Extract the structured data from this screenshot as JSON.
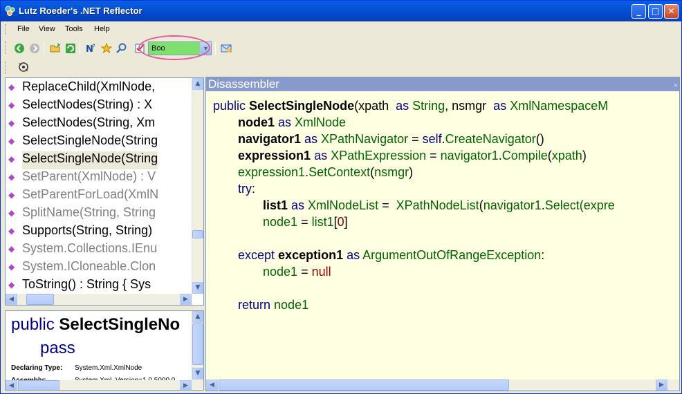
{
  "window": {
    "title": "Lutz Roeder's .NET Reflector"
  },
  "menu": [
    "File",
    "View",
    "Tools",
    "Help"
  ],
  "toolbar": {
    "language": "Boo"
  },
  "tree": {
    "items": [
      {
        "label": "ReplaceChild(XmlNode,",
        "gray": false
      },
      {
        "label": "SelectNodes(String) : X",
        "gray": false
      },
      {
        "label": "SelectNodes(String, Xm",
        "gray": false
      },
      {
        "label": "SelectSingleNode(String",
        "gray": false
      },
      {
        "label": "SelectSingleNode(String",
        "gray": false,
        "selected": true
      },
      {
        "label": "SetParent(XmlNode) : V",
        "gray": true
      },
      {
        "label": "SetParentForLoad(XmlN",
        "gray": true
      },
      {
        "label": "SplitName(String, String",
        "gray": true
      },
      {
        "label": "Supports(String, String)",
        "gray": false
      },
      {
        "label": "System.Collections.IEnu",
        "gray": true
      },
      {
        "label": "System.ICloneable.Clon",
        "gray": true
      },
      {
        "label": "ToString() : String { Sys",
        "gray": false
      }
    ]
  },
  "doc": {
    "sig_kw": "public",
    "sig_name": "SelectSingleNo",
    "sig_line2": "pass",
    "declaring_type_label": "Declaring Type:",
    "declaring_type_value": "System.Xml.XmlNode",
    "assembly_label": "Assembly:",
    "assembly_value": "System.Xml, Version=1.0.5000.0"
  },
  "disassembler": {
    "title": "Disassembler",
    "close": "×",
    "lines": {
      "l1_kw": "public ",
      "l1_name": "SelectSingleNode",
      "l1_a": "(xpath  ",
      "l1_as1": "as ",
      "l1_t1": "String",
      "l1_b": ", nsmgr  ",
      "l1_as2": "as ",
      "l1_t2": "XmlNamespaceM",
      "l2_name": "node1 ",
      "l2_as": "as ",
      "l2_t": "XmlNode",
      "l3_name": "navigator1 ",
      "l3_as": "as ",
      "l3_t": "XPathNavigator",
      "l3_eq": " = ",
      "l3_self": "self",
      "l3_dot": ".",
      "l3_call": "CreateNavigator",
      "l3_par": "()",
      "l4_name": "expression1 ",
      "l4_as": "as ",
      "l4_t": "XPathExpression",
      "l4_eq": " = ",
      "l4_obj": "navigator1",
      "l4_dot": ".",
      "l4_call": "Compile",
      "l4_p1": "(",
      "l4_arg": "xpath",
      "l4_p2": ")",
      "l5_obj": "expression1",
      "l5_dot": ".",
      "l5_call": "SetContext",
      "l5_p1": "(",
      "l5_arg": "nsmgr",
      "l5_p2": ")",
      "l6_kw": "try",
      "l6_colon": ":",
      "l7_name": "list1 ",
      "l7_as": "as ",
      "l7_t": "XmlNodeList",
      "l7_eq": " =  ",
      "l7_t2": "XPathNodeList",
      "l7_p1": "(",
      "l7_obj": "navigator1",
      "l7_dot": ".",
      "l7_call": "Select",
      "l7_rest": "(expre",
      "l8_id": "node1",
      "l8_eq": " = ",
      "l8_id2": "list1",
      "l8_b1": "[",
      "l8_num": "0",
      "l8_b2": "]",
      "l9_kw": "except ",
      "l9_name": "exception1 ",
      "l9_as": "as ",
      "l9_t": "ArgumentOutOfRangeException",
      "l9_colon": ":",
      "l10_id": "node1",
      "l10_eq": " = ",
      "l10_null": "null",
      "l11_kw": "return ",
      "l11_id": "node1"
    }
  }
}
